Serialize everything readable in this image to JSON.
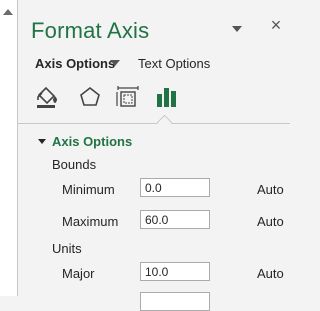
{
  "pane": {
    "title": "Format Axis"
  },
  "tabs": {
    "axis_options": "Axis Options",
    "text_options": "Text Options"
  },
  "icons": [
    "paint-bucket-icon",
    "pentagon-icon",
    "size-properties-icon",
    "bar-chart-icon"
  ],
  "colors": {
    "accent": "#217346",
    "background": "#f3f3f3"
  },
  "section": {
    "title": "Axis Options",
    "bounds_label": "Bounds",
    "units_label": "Units"
  },
  "fields": {
    "minimum": {
      "label": "Minimum",
      "value": "0.0",
      "status": "Auto"
    },
    "maximum": {
      "label": "Maximum",
      "value": "60.0",
      "status": "Auto"
    },
    "major": {
      "label": "Major",
      "value": "10.0",
      "status": "Auto"
    }
  }
}
